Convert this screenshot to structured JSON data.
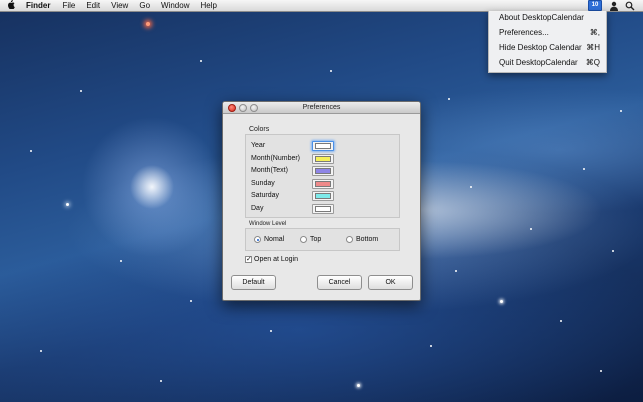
{
  "menubar": {
    "apple_icon": "apple-logo",
    "items": [
      "Finder",
      "File",
      "Edit",
      "View",
      "Go",
      "Window",
      "Help"
    ],
    "status": {
      "calendar_icon_text": "10",
      "user_icon": "user-icon",
      "spotlight_icon": "magnifier-icon"
    }
  },
  "app_menu": {
    "items": [
      {
        "label": "About DesktopCalendar",
        "shortcut": ""
      },
      {
        "label": "Preferences...",
        "shortcut": "⌘,"
      },
      {
        "label": "Hide Desktop Calendar",
        "shortcut": "⌘H"
      },
      {
        "label": "Quit DesktopCalendar",
        "shortcut": "⌘Q"
      }
    ]
  },
  "preferences": {
    "title": "Preferences",
    "colors_label": "Colors",
    "color_rows": [
      {
        "label": "Year",
        "color": "#ffffff"
      },
      {
        "label": "Month(Number)",
        "color": "#f5f05a"
      },
      {
        "label": "Month(Text)",
        "color": "#8e85e6"
      },
      {
        "label": "Sunday",
        "color": "#ee8a8a"
      },
      {
        "label": "Saturday",
        "color": "#7eeaea"
      },
      {
        "label": "Day",
        "color": "#ffffff"
      }
    ],
    "window_level_label": "Window Level",
    "window_level_options": [
      {
        "label": "Nomal",
        "selected": true
      },
      {
        "label": "Top",
        "selected": false
      },
      {
        "label": "Bottom",
        "selected": false
      }
    ],
    "open_at_login_label": "Open at Login",
    "open_at_login_checked": true,
    "buttons": {
      "default": "Default",
      "cancel": "Cancel",
      "ok": "OK"
    }
  }
}
